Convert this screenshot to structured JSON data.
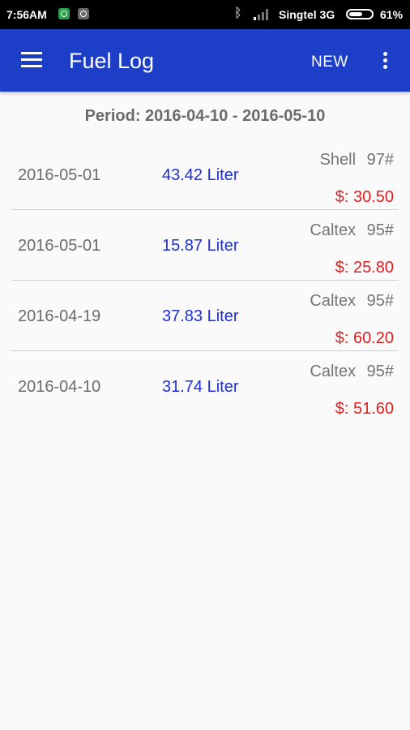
{
  "status_bar": {
    "time": "7:56AM",
    "carrier": "Singtel 3G",
    "battery_percent": "61%",
    "battery_level": 0.61
  },
  "app_bar": {
    "title": "Fuel Log",
    "new_label": "NEW",
    "color": "#1d3ec7"
  },
  "period_label": "Period: 2016-04-10 - 2016-05-10",
  "entries": [
    {
      "date": "2016-05-01",
      "liters": "43.42 Liter",
      "fuel": "Shell 97#",
      "price": "$: 30.50"
    },
    {
      "date": "2016-05-01",
      "liters": "15.87 Liter",
      "fuel": "Caltex 95#",
      "price": "$: 25.80"
    },
    {
      "date": "2016-04-19",
      "liters": "37.83 Liter",
      "fuel": "Caltex 95#",
      "price": "$: 60.20"
    },
    {
      "date": "2016-04-10",
      "liters": "31.74 Liter",
      "fuel": "Caltex 95#",
      "price": "$: 51.60"
    }
  ]
}
